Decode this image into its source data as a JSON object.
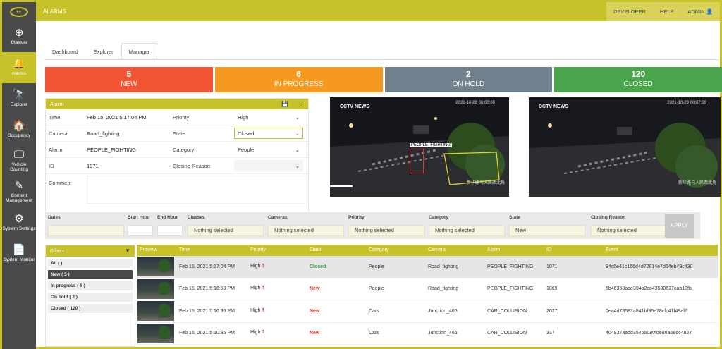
{
  "app": {
    "title": "ALARMS",
    "logo_icon": "eye-logo-icon",
    "logo_text": "••"
  },
  "topnav": {
    "developer": "DEVELOPER",
    "help": "HELP",
    "admin": "ADMIN",
    "admin_icon": "👤"
  },
  "sidebar": {
    "items": [
      {
        "label": "Classes",
        "icon": "⊕"
      },
      {
        "label": "Alarms",
        "icon": "🔔"
      },
      {
        "label": "Explorer",
        "icon": "🔭"
      },
      {
        "label": "Occupancy",
        "icon": "🏠"
      },
      {
        "label": "Vehicle Counting",
        "icon": "🖵"
      },
      {
        "label": "Content Management",
        "icon": "✎"
      },
      {
        "label": "System Settings",
        "icon": "⚙"
      },
      {
        "label": "System Monitor",
        "icon": "📄"
      }
    ]
  },
  "tabs": [
    "Dashboard",
    "Explorer",
    "Manager"
  ],
  "status": [
    {
      "count": "5",
      "label": "NEW",
      "color": "#f25533"
    },
    {
      "count": "6",
      "label": "IN PROGRESS",
      "color": "#f59a1f"
    },
    {
      "count": "2",
      "label": "ON HOLD",
      "color": "#70808c"
    },
    {
      "count": "120",
      "label": "CLOSED",
      "color": "#4aa64c"
    }
  ],
  "alarm": {
    "title": "Alarm",
    "save_icon": "💾",
    "menu_icon": "⋮",
    "time_label": "Time",
    "time_value": "Feb 15, 2021 5:17:04 PM",
    "priority_label": "Priority",
    "priority_value": "High",
    "camera_label": "Camera",
    "camera_value": "Road_fighting",
    "state_label": "State",
    "state_value": "Closed",
    "alarm_label": "Alarm",
    "alarm_value": "PEOPLE_FIGHTING",
    "category_label": "Category",
    "category_value": "People",
    "id_label": "ID",
    "id_value": "1071",
    "closing_label": "Closing Reason",
    "closing_value": "",
    "comment_label": "Comment",
    "chevron": "⌄"
  },
  "camera1": {
    "brand": "CCTV NEWS",
    "timestamp": "2021-10-29 00:00:00",
    "bbox_label": "PEOPLE_FIGHTING",
    "caption": "新华路与人民西北角"
  },
  "camera2": {
    "brand": "CCTV NEWS",
    "timestamp": "2021-10-29 00:07:39",
    "caption": "新华路与人民西北角"
  },
  "filters": {
    "dates_label": "Dates",
    "start_hour_label": "Start Hour",
    "end_hour_label": "End Hour",
    "classes_label": "Classes",
    "classes_value": "Nothing selected",
    "cameras_label": "Cameras",
    "cameras_value": "Nothing selected",
    "priority_label": "Priority",
    "priority_value": "Nothing selected",
    "category_label": "Category",
    "category_value": "Nothing selected",
    "state_label": "State",
    "state_value": "New",
    "closing_label": "Closing Reason",
    "closing_value": "Nothing selected",
    "apply": "APPLY"
  },
  "filter_list": {
    "title": "Filters",
    "filter_icon": "▼",
    "items": [
      "All ( )",
      "New ( 5 )",
      "In progress ( 6 )",
      "On hold ( 2 )",
      "Closed ( 120 )"
    ]
  },
  "table": {
    "columns": [
      "Preview",
      "Time",
      "Priority",
      "State",
      "Category",
      "Camera",
      "Alarm",
      "ID",
      "Event"
    ],
    "rows": [
      {
        "time": "Feb 15, 2021 5:17:04 PM",
        "priority": "High",
        "state": "Closed",
        "category": "People",
        "camera": "Road_fighting",
        "alarm": "PEOPLE_FIGHTING",
        "id": "1071",
        "event": "94c5e41c166d4d72814e7d64eb48c430"
      },
      {
        "time": "Feb 15, 2021 5:16:59 PM",
        "priority": "High",
        "state": "New",
        "category": "People",
        "camera": "Road_fighting",
        "alarm": "PEOPLE_FIGHTING",
        "id": "1069",
        "event": "6b46350aae394a2ca43530627cab19fb"
      },
      {
        "time": "Feb 15, 2021 5:16:35 PM",
        "priority": "High",
        "state": "New",
        "category": "Cars",
        "camera": "Junction_465",
        "alarm": "CAR_COLLISION",
        "id": "2027",
        "event": "0ea4d78587a841bf95e78cfc41f49af6"
      },
      {
        "time": "Feb 15, 2021 5:10:35 PM",
        "priority": "High",
        "state": "New",
        "category": "Cars",
        "camera": "Junction_465",
        "alarm": "CAR_COLLISION",
        "id": "337",
        "event": "404837aadd35455080fde86a686c4827"
      }
    ],
    "priority_arrow": "🡑"
  }
}
